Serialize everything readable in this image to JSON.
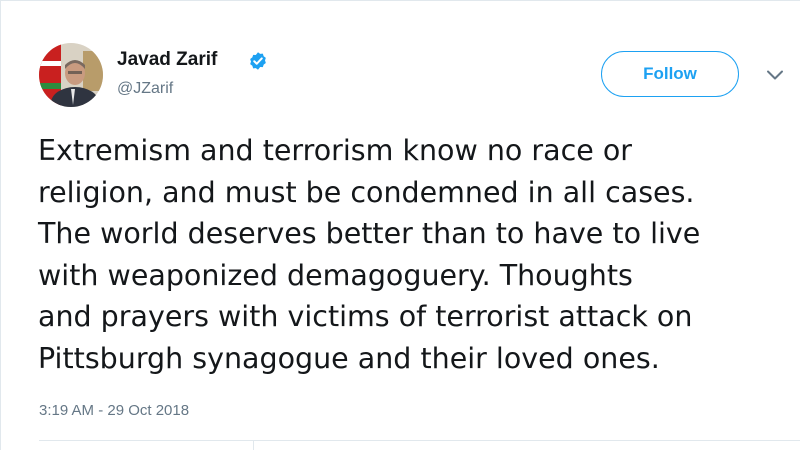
{
  "tweet": {
    "author": {
      "display_name": "Javad Zarif",
      "handle": "@JZarif",
      "verified": true,
      "avatar_icon": "profile-photo"
    },
    "follow_label": "Follow",
    "menu_icon": "chevron-down-icon",
    "text_lines": [
      "Extremism and terrorism know no race or",
      "religion, and must be condemned in all cases.",
      "The world deserves better than to have to live",
      "with weaponized demagoguery. Thoughts",
      "and prayers with victims of terrorist attack on",
      "Pittsburgh synagogue and their loved ones."
    ],
    "timestamp": "3:19 AM - 29 Oct 2018"
  },
  "colors": {
    "accent": "#1da1f2",
    "text": "#14171a",
    "muted": "#657786",
    "divider": "#e1e8ed"
  }
}
